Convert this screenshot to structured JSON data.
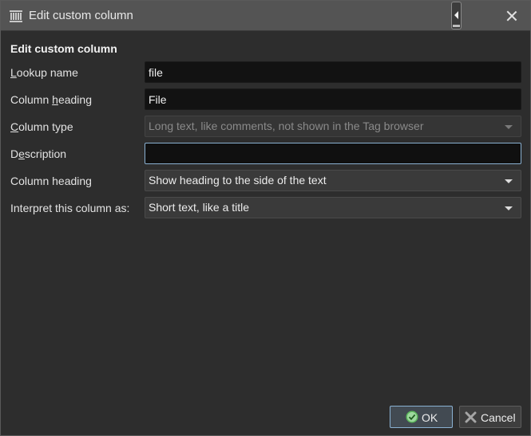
{
  "window": {
    "title": "Edit custom column",
    "icon": "library-icon",
    "close_icon": "close-icon"
  },
  "form": {
    "section_title": "Edit custom column",
    "lookup_name": {
      "label_pre": "",
      "label_mnemonic": "L",
      "label_post": "ookup name",
      "value": "file"
    },
    "column_heading": {
      "label_pre": "Column ",
      "label_mnemonic": "h",
      "label_post": "eading",
      "value": "File"
    },
    "column_type": {
      "label_pre": "",
      "label_mnemonic": "C",
      "label_post": "olumn type",
      "value": "Long text, like comments, not shown in the Tag browser"
    },
    "description": {
      "label_pre": "D",
      "label_mnemonic": "e",
      "label_post": "scription",
      "value": ""
    },
    "heading_position": {
      "label": "Column heading",
      "value": "Show heading to the side of the text"
    },
    "interpret_as": {
      "label": "Interpret this column as:",
      "value": "Short text, like a title"
    }
  },
  "buttons": {
    "ok": "OK",
    "cancel": "Cancel"
  },
  "colors": {
    "background": "#2d2d2d",
    "titlebar": "#545454",
    "field": "#121212",
    "focus_border": "#8ab1d2",
    "ok_icon": "#5cb85c",
    "cancel_icon": "#9a9a9a"
  }
}
